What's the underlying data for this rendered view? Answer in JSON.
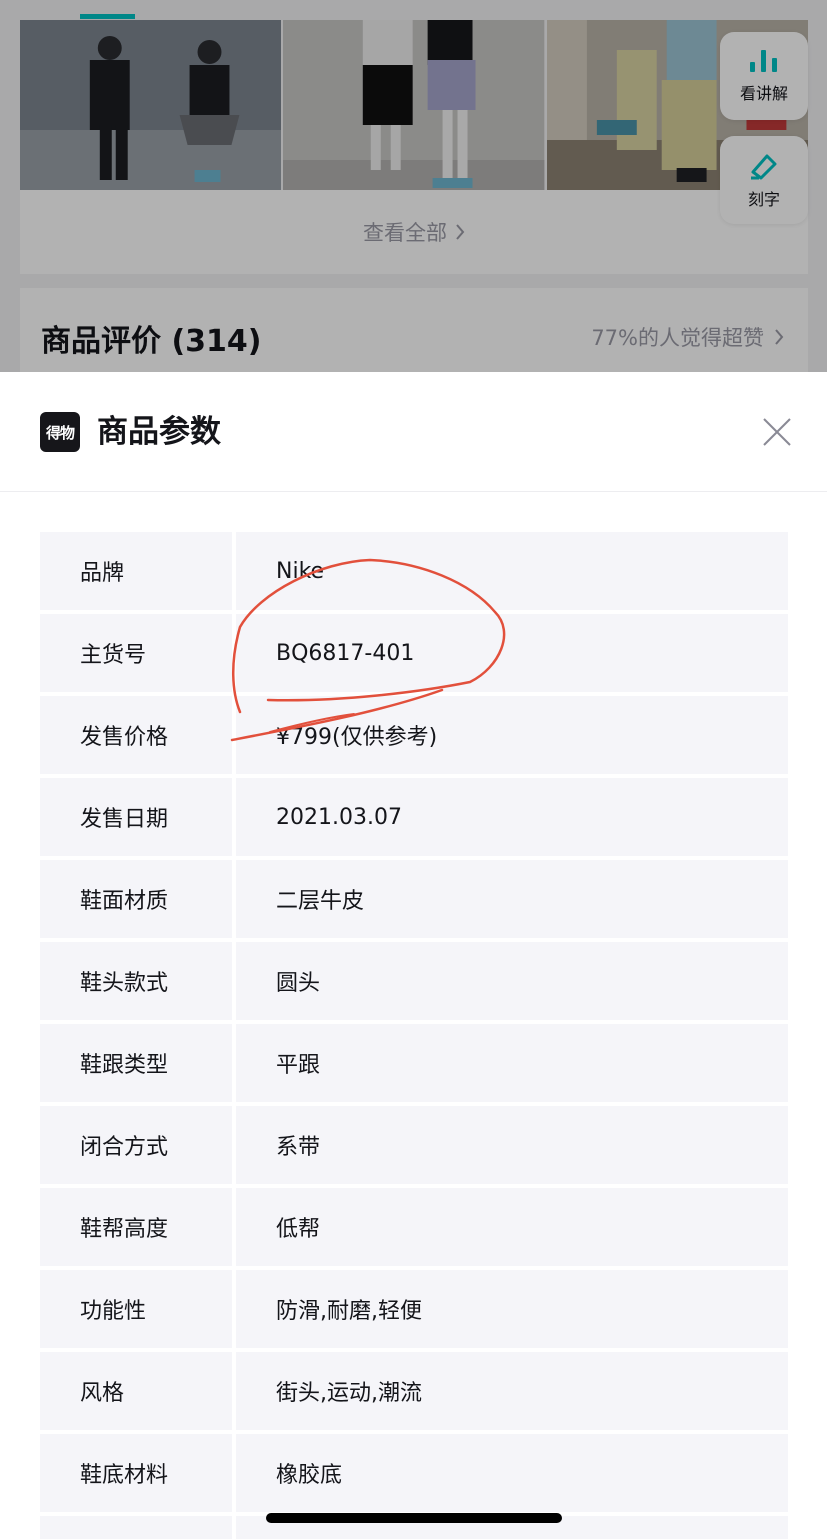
{
  "background": {
    "see_all": "查看全部",
    "review_title": "商品评价 (314)",
    "review_link": "77%的人觉得超赞",
    "float_buttons": [
      {
        "label": "看讲解",
        "icon": "bar-chart-icon"
      },
      {
        "label": "刻字",
        "icon": "pen-icon"
      }
    ]
  },
  "sheet": {
    "logo": "得物",
    "title": "商品参数",
    "params": [
      {
        "key": "品牌",
        "value": "Nike"
      },
      {
        "key": "主货号",
        "value": "BQ6817-401"
      },
      {
        "key": "发售价格",
        "value": "¥799(仅供参考)"
      },
      {
        "key": "发售日期",
        "value": "2021.03.07"
      },
      {
        "key": "鞋面材质",
        "value": "二层牛皮"
      },
      {
        "key": "鞋头款式",
        "value": "圆头"
      },
      {
        "key": "鞋跟类型",
        "value": "平跟"
      },
      {
        "key": "闭合方式",
        "value": "系带"
      },
      {
        "key": "鞋帮高度",
        "value": "低帮"
      },
      {
        "key": "功能性",
        "value": "防滑,耐磨,轻便"
      },
      {
        "key": "风格",
        "value": "街头,运动,潮流"
      },
      {
        "key": "鞋底材料",
        "value": "橡胶底"
      },
      {
        "key": "",
        "value": ""
      }
    ]
  },
  "colors": {
    "accent": "#01c2c3",
    "annotation": "#e2503c",
    "row_bg": "#f5f5f9"
  }
}
